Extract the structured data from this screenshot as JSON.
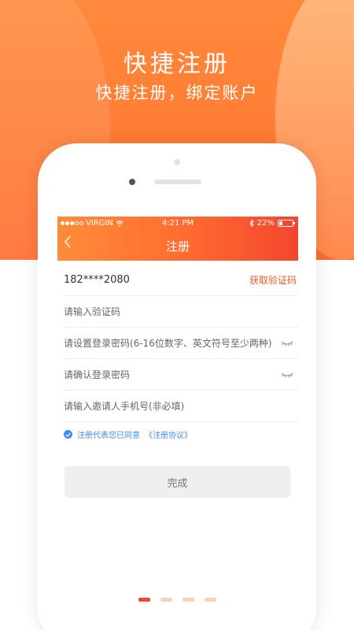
{
  "hero": {
    "title": "快捷注册",
    "subtitle": "快捷注册，绑定账户"
  },
  "statusbar": {
    "carrier": "VIRGIN",
    "time": "4:21 PM",
    "battery": "22%"
  },
  "navbar": {
    "back_icon": "chevron-left-icon",
    "title": "注册"
  },
  "form": {
    "phone_value": "182****2080",
    "get_code_label": "获取验证码",
    "code_placeholder": "请输入验证码",
    "password_placeholder": "请设置登录密码(6-16位数字、英文符号至少两种)",
    "confirm_placeholder": "请确认登录密码",
    "invite_placeholder": "请输入邀请人手机号(非必填)",
    "agree_text": "注册代表您已同意",
    "agreement_link": "《注册协议》",
    "submit_label": "完成"
  },
  "pager": {
    "count": 4,
    "active_index": 0
  },
  "colors": {
    "accent": "#ff7a33",
    "link": "#f2582a",
    "check": "#3f8ef0"
  }
}
